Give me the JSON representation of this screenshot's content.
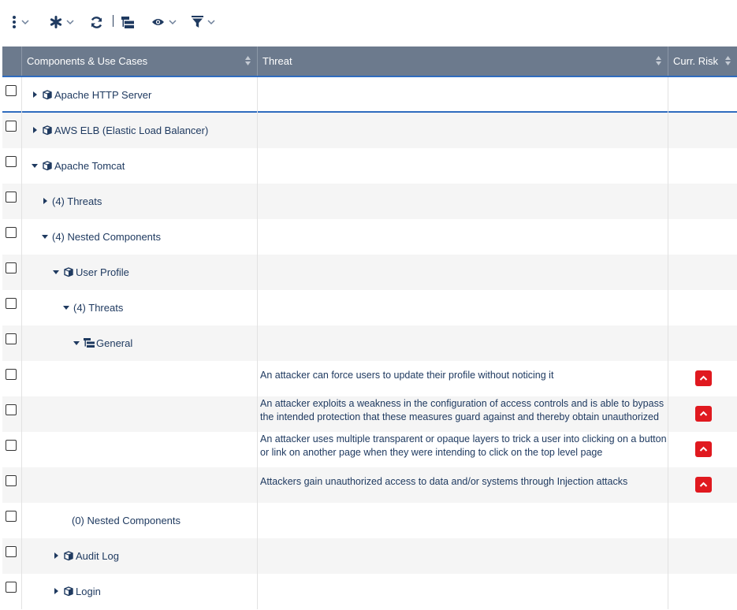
{
  "toolbar": {
    "icons": [
      "more-vertical-icon",
      "asterisk-icon",
      "refresh-icon",
      "tree-view-icon",
      "eye-icon",
      "filter-icon"
    ]
  },
  "columns": [
    "Components & Use Cases",
    "Threat",
    "Curr. Risk"
  ],
  "rows": [
    {
      "label": "Apache HTTP Server",
      "icon": "component-icon",
      "toggle": "collapsed",
      "threat": "",
      "risk": false
    },
    {
      "label": "AWS ELB (Elastic Load Balancer)",
      "icon": "component-icon",
      "toggle": "collapsed",
      "threat": "",
      "risk": false
    },
    {
      "label": "Apache Tomcat",
      "icon": "component-icon",
      "toggle": "expanded",
      "threat": "",
      "risk": false
    },
    {
      "label": "(4) Threats",
      "icon": "",
      "toggle": "collapsed",
      "threat": "",
      "risk": false
    },
    {
      "label": "(4) Nested Components",
      "icon": "",
      "toggle": "expanded",
      "threat": "",
      "risk": false
    },
    {
      "label": "User Profile",
      "icon": "component-icon",
      "toggle": "expanded",
      "threat": "",
      "risk": false
    },
    {
      "label": "(4) Threats",
      "icon": "",
      "toggle": "expanded",
      "threat": "",
      "risk": false
    },
    {
      "label": "General",
      "icon": "use-case-icon",
      "toggle": "expanded",
      "threat": "",
      "risk": false
    },
    {
      "label": "",
      "icon": "",
      "toggle": "",
      "threat": "An attacker can force users to update their profile without noticing it",
      "risk": true,
      "risk_level": "high"
    },
    {
      "label": "",
      "icon": "",
      "toggle": "",
      "threat": "An attacker exploits a weakness in the configuration of access controls and is able to bypass the intended protection that these measures guard against and thereby obtain unauthorized access to the application",
      "risk": true,
      "risk_level": "high"
    },
    {
      "label": "",
      "icon": "",
      "toggle": "",
      "threat": "An attacker uses multiple transparent or opaque layers to trick a user into clicking on a button or link on another page when they were intending to click on the top level page",
      "risk": true,
      "risk_level": "high"
    },
    {
      "label": "",
      "icon": "",
      "toggle": "",
      "threat": "Attackers gain unauthorized access to data and/or systems through Injection attacks",
      "risk": true,
      "risk_level": "high"
    },
    {
      "label": "(0) Nested Components",
      "icon": "",
      "toggle": "",
      "threat": "",
      "risk": false
    },
    {
      "label": "Audit Log",
      "icon": "component-icon",
      "toggle": "collapsed",
      "threat": "",
      "risk": false
    },
    {
      "label": "Login",
      "icon": "component-icon",
      "toggle": "collapsed",
      "threat": "",
      "risk": false
    }
  ],
  "colors": {
    "header": "#6c7a8d",
    "accent": "#2f6cbf",
    "risk_high": "#e0191f",
    "text": "#1f3a60"
  }
}
